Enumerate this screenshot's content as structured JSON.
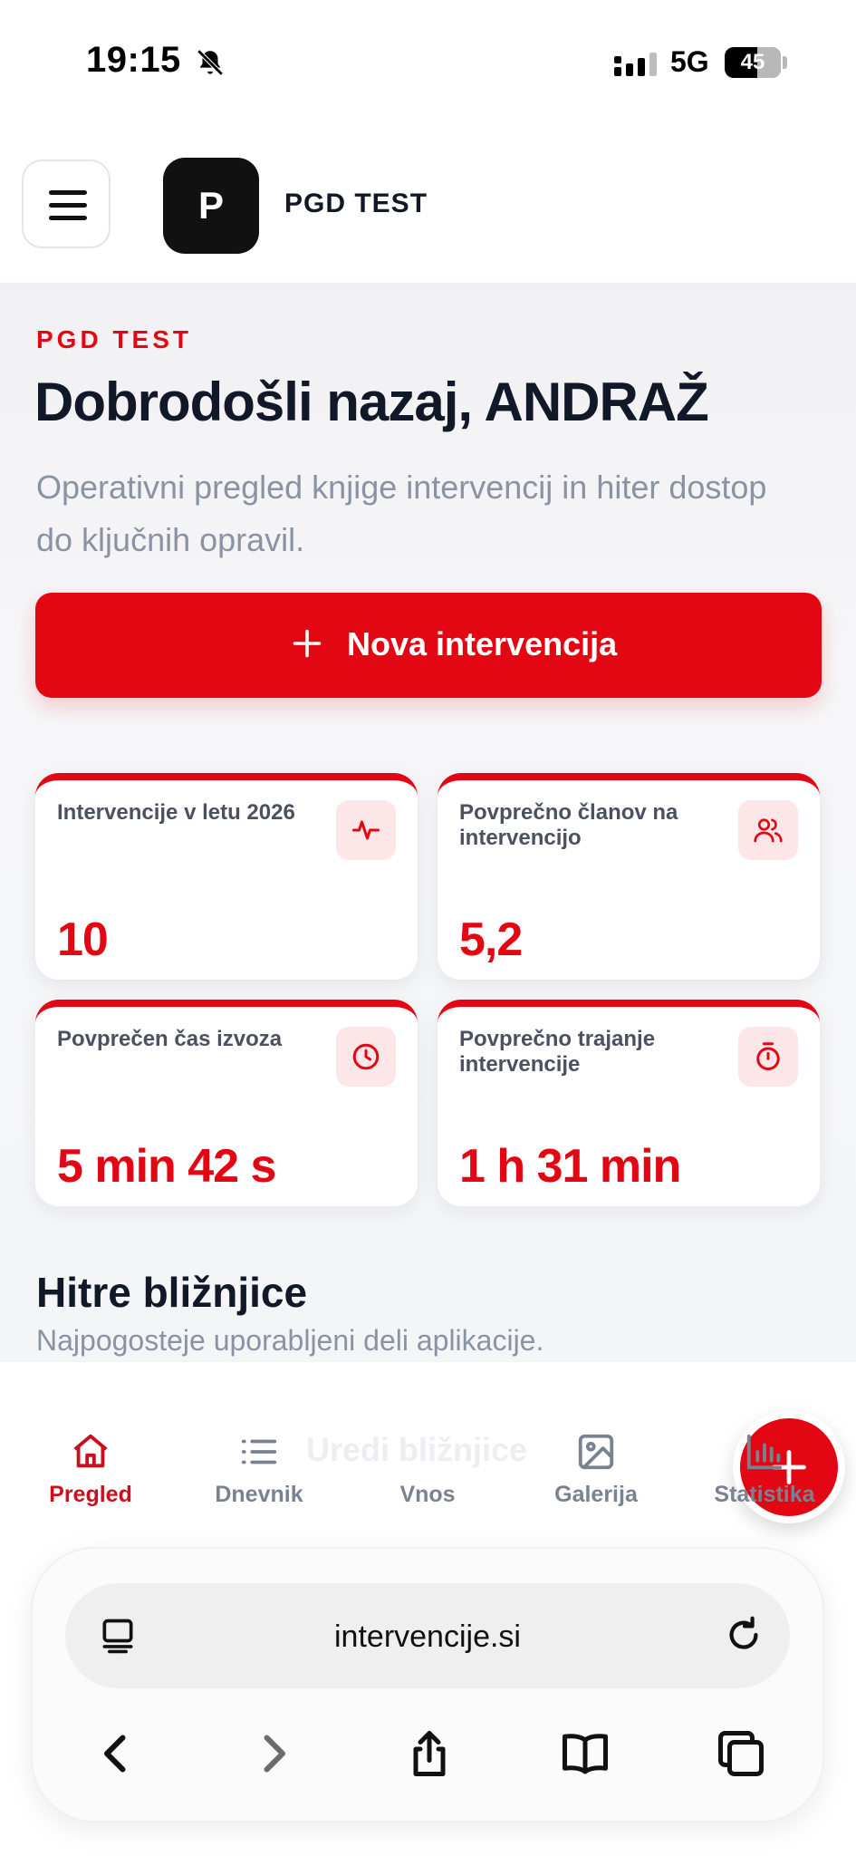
{
  "status_bar": {
    "time": "19:15",
    "network": "5G",
    "battery": "45"
  },
  "header": {
    "logo_letter": "P",
    "brand": "PGD TEST"
  },
  "hero": {
    "eyebrow": "PGD TEST",
    "welcome": "Dobrodošli nazaj, ANDRAŽ",
    "subtitle": "Operativni pregled knjige intervencij in hiter dostop do ključnih opravil.",
    "new_button": "Nova intervencija"
  },
  "stats": [
    {
      "title": "Intervencije v letu 2026",
      "value": "10",
      "icon": "activity-icon"
    },
    {
      "title": "Povprečno članov na intervencijo",
      "value": "5,2",
      "icon": "users-icon"
    },
    {
      "title": "Povprečen čas izvoza",
      "value": "5 min 42 s",
      "icon": "clock-icon"
    },
    {
      "title": "Povprečno trajanje intervencije",
      "value": "1 h 31 min",
      "icon": "timer-icon"
    }
  ],
  "shortcuts": {
    "title": "Hitre bližnjice",
    "subtitle": "Najpogosteje uporabljeni deli aplikacije.",
    "partial_card": "Uredi bližnjice"
  },
  "bottom_nav": {
    "items": [
      {
        "label": "Pregled",
        "icon": "home-icon",
        "active": true
      },
      {
        "label": "Dnevnik",
        "icon": "list-icon"
      },
      {
        "label": "Vnos",
        "icon": "plus-icon"
      },
      {
        "label": "Galerija",
        "icon": "image-icon"
      },
      {
        "label": "Statistika",
        "icon": "bar-chart-icon"
      }
    ]
  },
  "browser": {
    "url": "intervencije.si"
  },
  "colors": {
    "accent": "#e30613",
    "text": "#111827",
    "muted": "#8a93a3"
  }
}
